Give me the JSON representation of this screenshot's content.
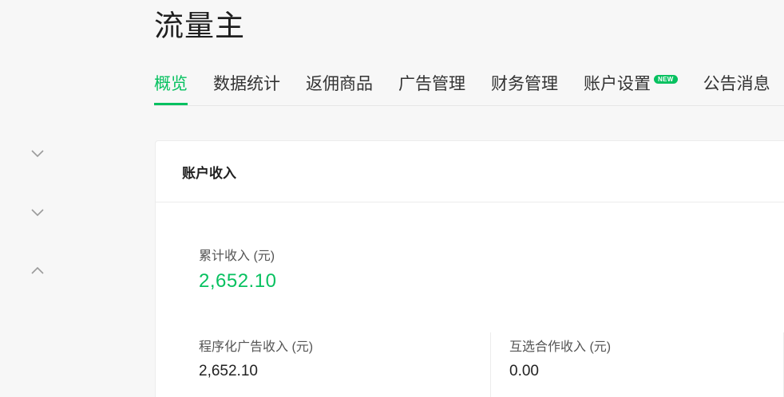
{
  "header": {
    "title": "流量主"
  },
  "tabs": [
    {
      "label": "概览",
      "active": true
    },
    {
      "label": "数据统计",
      "active": false
    },
    {
      "label": "返佣商品",
      "active": false
    },
    {
      "label": "广告管理",
      "active": false
    },
    {
      "label": "财务管理",
      "active": false
    },
    {
      "label": "账户设置",
      "active": false,
      "badge": "NEW"
    },
    {
      "label": "公告消息",
      "active": false
    }
  ],
  "sidebar": {
    "chevrons": [
      "chevron-down-icon",
      "chevron-down-icon",
      "chevron-up-icon"
    ]
  },
  "card": {
    "title": "账户收入",
    "total": {
      "label": "累计收入 (元)",
      "value": "2,652.10"
    },
    "programmatic": {
      "label": "程序化广告收入 (元)",
      "value": "2,652.10"
    },
    "mutual": {
      "label": "互选合作收入 (元)",
      "value": "0.00"
    }
  },
  "colors": {
    "accent": "#07c160",
    "background": "#f7f7f7",
    "card": "#ffffff",
    "text": "#222222"
  }
}
